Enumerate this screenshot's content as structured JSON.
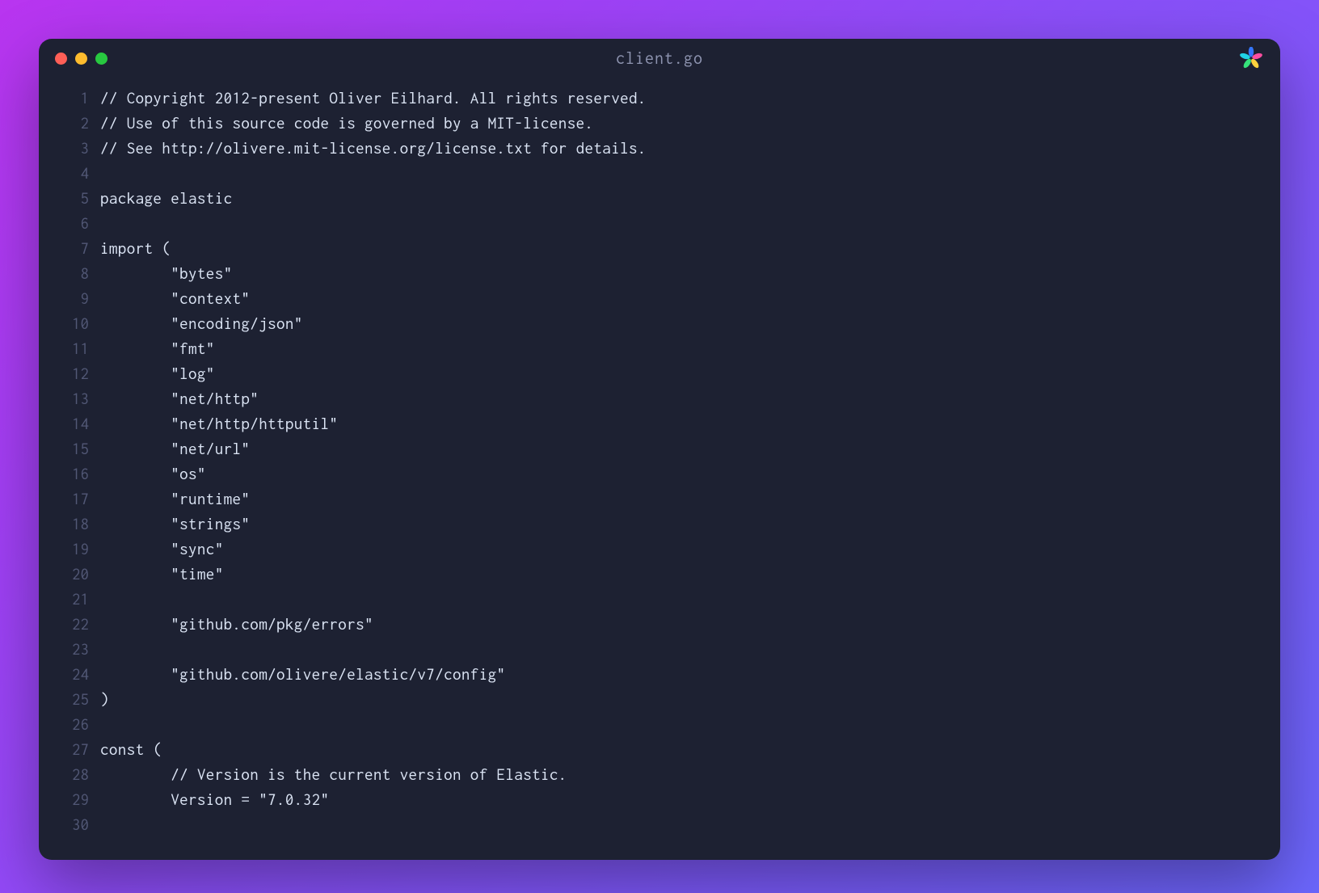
{
  "window": {
    "title": "client.go",
    "traffic_lights": {
      "close_color": "#ff5f57",
      "minimize_color": "#febc2e",
      "maximize_color": "#28c840"
    }
  },
  "code": {
    "lines": [
      {
        "num": "1",
        "text": "// Copyright 2012-present Oliver Eilhard. All rights reserved."
      },
      {
        "num": "2",
        "text": "// Use of this source code is governed by a MIT-license."
      },
      {
        "num": "3",
        "text": "// See http://olivere.mit-license.org/license.txt for details."
      },
      {
        "num": "4",
        "text": ""
      },
      {
        "num": "5",
        "text": "package elastic"
      },
      {
        "num": "6",
        "text": ""
      },
      {
        "num": "7",
        "text": "import ("
      },
      {
        "num": "8",
        "text": "        \"bytes\""
      },
      {
        "num": "9",
        "text": "        \"context\""
      },
      {
        "num": "10",
        "text": "        \"encoding/json\""
      },
      {
        "num": "11",
        "text": "        \"fmt\""
      },
      {
        "num": "12",
        "text": "        \"log\""
      },
      {
        "num": "13",
        "text": "        \"net/http\""
      },
      {
        "num": "14",
        "text": "        \"net/http/httputil\""
      },
      {
        "num": "15",
        "text": "        \"net/url\""
      },
      {
        "num": "16",
        "text": "        \"os\""
      },
      {
        "num": "17",
        "text": "        \"runtime\""
      },
      {
        "num": "18",
        "text": "        \"strings\""
      },
      {
        "num": "19",
        "text": "        \"sync\""
      },
      {
        "num": "20",
        "text": "        \"time\""
      },
      {
        "num": "21",
        "text": ""
      },
      {
        "num": "22",
        "text": "        \"github.com/pkg/errors\""
      },
      {
        "num": "23",
        "text": ""
      },
      {
        "num": "24",
        "text": "        \"github.com/olivere/elastic/v7/config\""
      },
      {
        "num": "25",
        "text": ")"
      },
      {
        "num": "26",
        "text": ""
      },
      {
        "num": "27",
        "text": "const ("
      },
      {
        "num": "28",
        "text": "        // Version is the current version of Elastic."
      },
      {
        "num": "29",
        "text": "        Version = \"7.0.32\""
      },
      {
        "num": "30",
        "text": ""
      }
    ]
  }
}
